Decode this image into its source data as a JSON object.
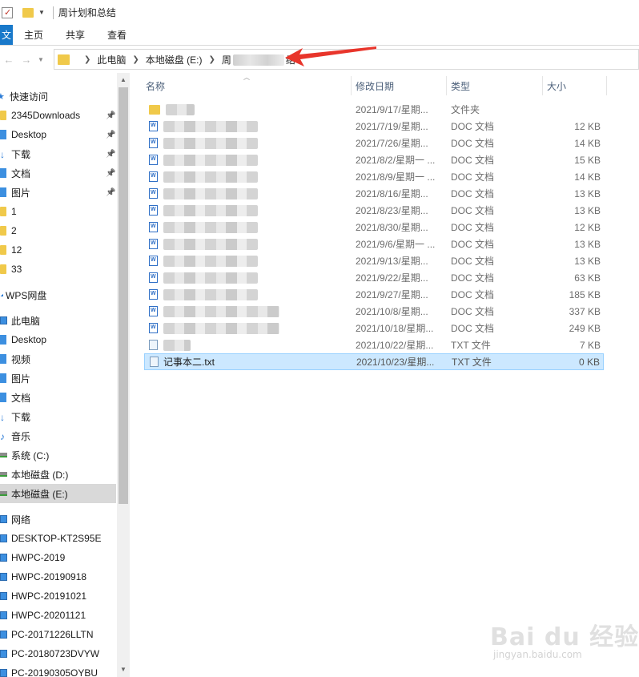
{
  "window": {
    "title": "周计划和总结"
  },
  "ribbon": {
    "file_label": "文",
    "tabs": [
      "主页",
      "共享",
      "查看"
    ]
  },
  "address": {
    "crumbs": [
      "此电脑",
      "本地磁盘 (E:)",
      "周",
      "结"
    ]
  },
  "sidebar": {
    "items": [
      {
        "label": "快速访问",
        "icon": "star-icon",
        "pinned": false
      },
      {
        "label": "2345Downloads",
        "icon": "folder-icon",
        "pinned": true
      },
      {
        "label": "Desktop",
        "icon": "desktop-icon",
        "pinned": true
      },
      {
        "label": "下载",
        "icon": "download-icon",
        "pinned": true
      },
      {
        "label": "文档",
        "icon": "documents-icon",
        "pinned": true
      },
      {
        "label": "图片",
        "icon": "pictures-icon",
        "pinned": true
      },
      {
        "label": "1",
        "icon": "folder-icon",
        "pinned": false
      },
      {
        "label": "2",
        "icon": "folder-icon",
        "pinned": false
      },
      {
        "label": "12",
        "icon": "folder-icon",
        "pinned": false
      },
      {
        "label": "33",
        "icon": "folder-icon",
        "pinned": false
      },
      {
        "label": "WPS网盘",
        "icon": "cloud-icon",
        "pinned": false
      },
      {
        "label": "此电脑",
        "icon": "computer-icon",
        "pinned": false
      },
      {
        "label": "Desktop",
        "icon": "desktop-icon",
        "pinned": false
      },
      {
        "label": "视频",
        "icon": "videos-icon",
        "pinned": false
      },
      {
        "label": "图片",
        "icon": "pictures-icon",
        "pinned": false
      },
      {
        "label": "文档",
        "icon": "documents-icon",
        "pinned": false
      },
      {
        "label": "下载",
        "icon": "download-icon",
        "pinned": false
      },
      {
        "label": "音乐",
        "icon": "music-icon",
        "pinned": false
      },
      {
        "label": "系统 (C:)",
        "icon": "drive-icon",
        "pinned": false
      },
      {
        "label": "本地磁盘 (D:)",
        "icon": "drive-icon",
        "pinned": false
      },
      {
        "label": "本地磁盘 (E:)",
        "icon": "drive-icon",
        "pinned": false
      },
      {
        "label": "网络",
        "icon": "network-icon",
        "pinned": false
      },
      {
        "label": "DESKTOP-KT2S95E",
        "icon": "computer-icon",
        "pinned": false
      },
      {
        "label": "HWPC-2019",
        "icon": "computer-icon",
        "pinned": false
      },
      {
        "label": "HWPC-20190918",
        "icon": "computer-icon",
        "pinned": false
      },
      {
        "label": "HWPC-20191021",
        "icon": "computer-icon",
        "pinned": false
      },
      {
        "label": "HWPC-20201121",
        "icon": "computer-icon",
        "pinned": false
      },
      {
        "label": "PC-20171226LLTN",
        "icon": "computer-icon",
        "pinned": false
      },
      {
        "label": "PC-20180723DVYW",
        "icon": "computer-icon",
        "pinned": false
      },
      {
        "label": "PC-20190305OYBU",
        "icon": "computer-icon",
        "pinned": false
      }
    ]
  },
  "columns": {
    "name": "名称",
    "date": "修改日期",
    "type": "类型",
    "size": "大小"
  },
  "files": [
    {
      "kind": "folder",
      "name": "",
      "date": "2021/9/17/星期...",
      "type": "文件夹",
      "size": ""
    },
    {
      "kind": "doc",
      "name": "",
      "date": "2021/7/19/星期...",
      "type": "DOC 文档",
      "size": "12 KB"
    },
    {
      "kind": "doc",
      "name": "",
      "date": "2021/7/26/星期...",
      "type": "DOC 文档",
      "size": "14 KB"
    },
    {
      "kind": "doc",
      "name": "",
      "date": "2021/8/2/星期一 ...",
      "type": "DOC 文档",
      "size": "15 KB"
    },
    {
      "kind": "doc",
      "name": "",
      "date": "2021/8/9/星期一 ...",
      "type": "DOC 文档",
      "size": "14 KB"
    },
    {
      "kind": "doc",
      "name": "",
      "date": "2021/8/16/星期...",
      "type": "DOC 文档",
      "size": "13 KB"
    },
    {
      "kind": "doc",
      "name": "",
      "date": "2021/8/23/星期...",
      "type": "DOC 文档",
      "size": "13 KB"
    },
    {
      "kind": "doc",
      "name": "",
      "date": "2021/8/30/星期...",
      "type": "DOC 文档",
      "size": "12 KB"
    },
    {
      "kind": "doc",
      "name": "",
      "date": "2021/9/6/星期一 ...",
      "type": "DOC 文档",
      "size": "13 KB"
    },
    {
      "kind": "doc",
      "name": "",
      "date": "2021/9/13/星期...",
      "type": "DOC 文档",
      "size": "13 KB"
    },
    {
      "kind": "doc",
      "name": "",
      "date": "2021/9/22/星期...",
      "type": "DOC 文档",
      "size": "63 KB"
    },
    {
      "kind": "doc",
      "name": "",
      "date": "2021/9/27/星期...",
      "type": "DOC 文档",
      "size": "185 KB"
    },
    {
      "kind": "doc",
      "name": "",
      "date": "2021/10/8/星期...",
      "type": "DOC 文档",
      "size": "337 KB"
    },
    {
      "kind": "doc",
      "name": "",
      "date": "2021/10/18/星期...",
      "type": "DOC 文档",
      "size": "249 KB"
    },
    {
      "kind": "txt",
      "name": "",
      "date": "2021/10/22/星期...",
      "type": "TXT 文件",
      "size": "7 KB"
    },
    {
      "kind": "txt",
      "name": "记事本二.txt",
      "date": "2021/10/23/星期...",
      "type": "TXT 文件",
      "size": "0 KB",
      "selected": true
    }
  ],
  "watermark": {
    "main": "Bai du 经验",
    "sub": "jingyan.baidu.com"
  },
  "colors": {
    "accent": "#1979ca",
    "selection": "#cce8ff",
    "folder": "#f0c94a",
    "arrow": "#e8352b"
  }
}
